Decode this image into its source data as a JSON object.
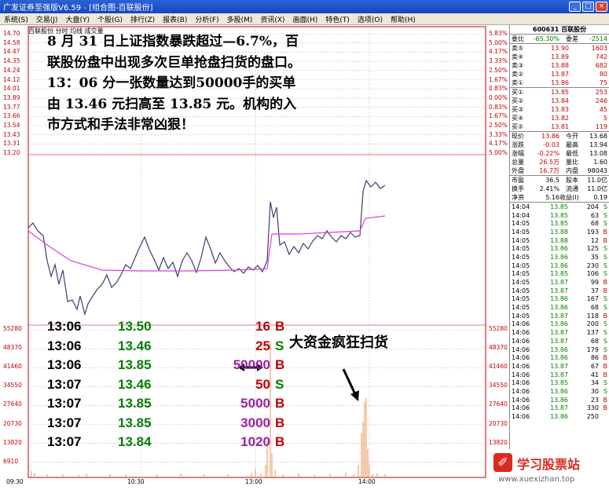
{
  "titlebar": {
    "title": "广发证券至强版V6.59 - [组合图-百联股份]",
    "min": "_",
    "max": "□",
    "close": "×"
  },
  "menu": [
    "系统(S)",
    "交易(J)",
    "大盘(Y)",
    "个股(G)",
    "排行(Z)",
    "报表(B)",
    "分析(F)",
    "多股(M)",
    "资讯(X)",
    "画面(H)",
    "特色(T)",
    "选项(O)",
    "帮助(H)"
  ],
  "chart_header": "百联股份  分时  均线  成交量",
  "yaxis": [
    "14.70",
    "14.58",
    "14.47",
    "14.35",
    "14.24",
    "14.12",
    "14.01",
    "13.89",
    "13.77",
    "13.66",
    "13.54",
    "13.43",
    "13.31",
    "13.20"
  ],
  "pcts": [
    "5.83%",
    "5.00%",
    "4.17%",
    "3.33%",
    "2.50%",
    "1.67%",
    "0.83%",
    "0.00%",
    "0.83%",
    "1.67%",
    "2.50%",
    "3.33%",
    "4.17%",
    "5.00%"
  ],
  "vol_left": [
    "55280",
    "48370",
    "41460",
    "34550",
    "27640",
    "20730",
    "13820",
    "6910"
  ],
  "vol_right": [
    "55280",
    "48370",
    "41460",
    "34550",
    "27640",
    "20730",
    "13820",
    "6910"
  ],
  "xaxis": [
    "09:30",
    "10:30",
    "13:00",
    "14:00"
  ],
  "annotation": "8 月 31 日上证指数暴跌超过—6.7%，百联股份盘中出现多次巨单抢盘扫货的盘口。13：06 分一张数量达到50000手的买单由 13.46 元扫高至 13.85 元。机构的入市方式和手法非常凶狠！",
  "big_label": "大资金疯狂扫货",
  "trades": [
    {
      "t": "13:06",
      "p": "13.50",
      "v": "16",
      "bs": "B"
    },
    {
      "t": "13:06",
      "p": "13.46",
      "v": "25",
      "bs": "S"
    },
    {
      "t": "13:06",
      "p": "13.85",
      "v": "50000",
      "bs": "B"
    },
    {
      "t": "13:07",
      "p": "13.46",
      "v": "50",
      "bs": "S"
    },
    {
      "t": "13:07",
      "p": "13.85",
      "v": "5000",
      "bs": "B"
    },
    {
      "t": "13:07",
      "p": "13.85",
      "v": "3000",
      "bs": "B"
    },
    {
      "t": "13:07",
      "p": "13.84",
      "v": "1020",
      "bs": "B"
    }
  ],
  "panel": {
    "code": "600631 百联股份",
    "weibi": [
      "委比",
      "-65.30%",
      "委差",
      "-2514"
    ],
    "sells": [
      [
        "卖⑤",
        "13.90",
        "1603"
      ],
      [
        "卖④",
        "13.89",
        "742"
      ],
      [
        "卖③",
        "13.88",
        "682"
      ],
      [
        "卖②",
        "13.87",
        "80"
      ],
      [
        "卖①",
        "13.86",
        "75"
      ]
    ],
    "buys": [
      [
        "买①",
        "13.85",
        "253"
      ],
      [
        "买②",
        "13.84",
        "246"
      ],
      [
        "买③",
        "13.83",
        "45"
      ],
      [
        "买④",
        "13.82",
        "5"
      ],
      [
        "买⑤",
        "13.81",
        "119"
      ]
    ],
    "stats": [
      [
        "现价",
        "13.86",
        "今开",
        "13.68"
      ],
      [
        "涨跌",
        "-0.03",
        "最高",
        "13.94"
      ],
      [
        "涨幅",
        "-0.22%",
        "最低",
        "13.08"
      ],
      [
        "总量",
        "26.5万",
        "量比",
        "1.60"
      ],
      [
        "外盘",
        "16.7万",
        "内盘",
        "98043"
      ]
    ],
    "stats2": [
      [
        "市盈",
        "36.5",
        "股本",
        "11.0亿"
      ],
      [
        "换手",
        "2.41%",
        "流通",
        "11.0亿"
      ],
      [
        "净资",
        "5.16",
        "收益(I)",
        "0.19"
      ]
    ],
    "ticks": [
      [
        "14:04",
        "13.85",
        "204",
        "S"
      ],
      [
        "14:04",
        "13.85",
        "63",
        "S"
      ],
      [
        "14:05",
        "13.85",
        "68",
        "S"
      ],
      [
        "14:05",
        "13.88",
        "193",
        "B"
      ],
      [
        "14:05",
        "13.88",
        "12",
        "B"
      ],
      [
        "14:05",
        "13.86",
        "125",
        "S"
      ],
      [
        "14:05",
        "13.86",
        "35",
        "S"
      ],
      [
        "14:05",
        "13.86",
        "230",
        "S"
      ],
      [
        "14:05",
        "13.85",
        "106",
        "S"
      ],
      [
        "14:05",
        "13.87",
        "99",
        "B"
      ],
      [
        "14:05",
        "13.87",
        "37",
        "B"
      ],
      [
        "14:05",
        "13.86",
        "167",
        "S"
      ],
      [
        "14:05",
        "13.86",
        "68",
        "S"
      ],
      [
        "14:05",
        "13.87",
        "118",
        "B"
      ],
      [
        "14:06",
        "13.86",
        "200",
        "S"
      ],
      [
        "14:06",
        "13.87",
        "137",
        "S"
      ],
      [
        "14:06",
        "13.87",
        "68",
        "S"
      ],
      [
        "14:06",
        "13.86",
        "179",
        "S"
      ],
      [
        "14:06",
        "13.86",
        "86",
        "B"
      ],
      [
        "14:06",
        "13.87",
        "67",
        "B"
      ],
      [
        "14:06",
        "13.87",
        "41",
        "B"
      ],
      [
        "14:06",
        "13.85",
        "34",
        "S"
      ],
      [
        "14:06",
        "13.86",
        "30",
        "S"
      ],
      [
        "14:06",
        "13.86",
        "23",
        "B"
      ],
      [
        "14:06",
        "13.87",
        "330",
        "B"
      ],
      [
        "14:06",
        "13.86",
        "250",
        ""
      ]
    ]
  },
  "watermark": {
    "title": "学习股票站",
    "url": "www.xuexizhan.top",
    "logo": "✐"
  }
}
